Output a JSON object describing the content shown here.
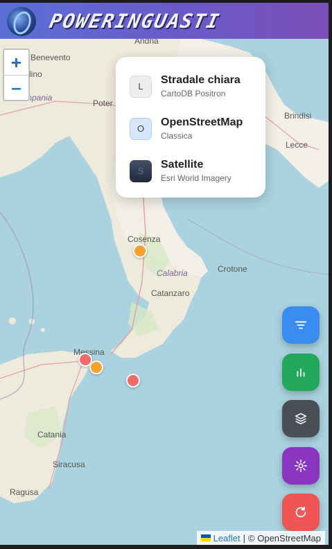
{
  "header": {
    "brand_name": "POWERINGUASTI",
    "logo_icon": "globe-logo"
  },
  "map_controls": {
    "zoom_in": "+",
    "zoom_out": "–"
  },
  "layer_panel": {
    "options": [
      {
        "icon_letter": "L",
        "title": "Stradale chiara",
        "subtitle": "CartoDB Positron"
      },
      {
        "icon_letter": "O",
        "title": "OpenStreetMap",
        "subtitle": "Classica"
      },
      {
        "icon_letter": "S",
        "title": "Satellite",
        "subtitle": "Esri World Imagery"
      }
    ]
  },
  "map_labels": {
    "andria": "Andria",
    "benevento": "Benevento",
    "lino": "lino",
    "campania": "mpania",
    "potenza": "Poter",
    "brindisi": "Brindisi",
    "lecce": "Lecce",
    "cosenza": "Cosenza",
    "calabria": "Calabria",
    "crotone": "Crotone",
    "catanzaro": "Catanzaro",
    "messina": "Messina",
    "catania": "Catania",
    "siracusa": "Siracusa",
    "ragusa": "Ragusa"
  },
  "fabs": [
    {
      "name": "filter",
      "color": "#3b8cf0"
    },
    {
      "name": "stats",
      "color": "#22a85a"
    },
    {
      "name": "layers",
      "color": "#4a4f57"
    },
    {
      "name": "settings",
      "color": "#8a35c2"
    },
    {
      "name": "refresh",
      "color": "#ef5552"
    }
  ],
  "markers": [
    {
      "color": "#f7a02c"
    },
    {
      "color": "#f26b6b"
    },
    {
      "color": "#f7a02c"
    },
    {
      "color": "#f26b6b"
    }
  ],
  "attribution": {
    "leaflet": "Leaflet",
    "separator": "|",
    "copyright": "© OpenStreetMap"
  }
}
